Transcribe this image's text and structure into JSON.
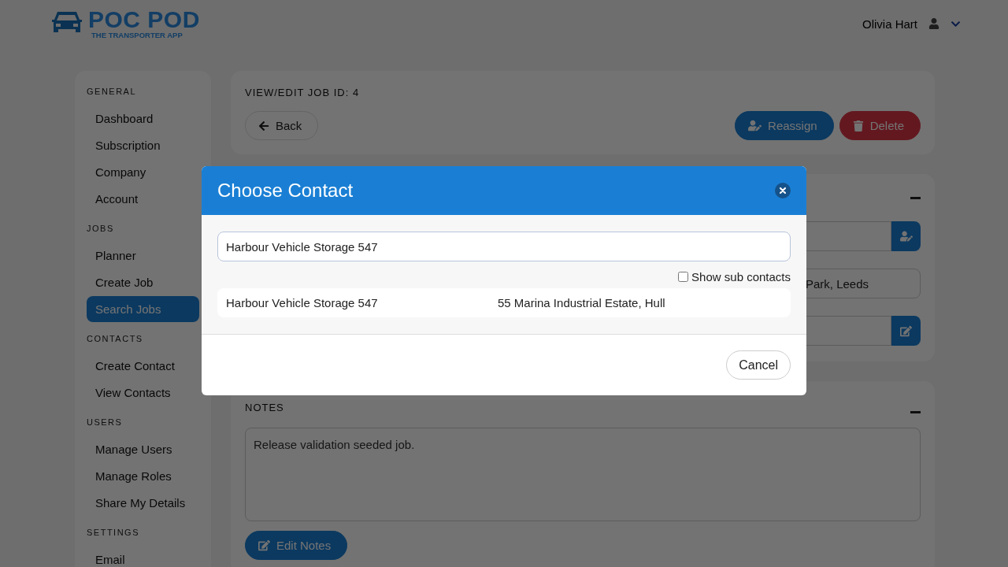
{
  "header": {
    "logo": {
      "title": "POC POD",
      "subtitle": "THE TRANSPORTER APP"
    },
    "user": {
      "name": "Olivia Hart"
    }
  },
  "sidebar": {
    "sections": [
      {
        "heading": "GENERAL",
        "items": [
          {
            "label": "Dashboard",
            "selected": false
          },
          {
            "label": "Subscription",
            "selected": false
          },
          {
            "label": "Company",
            "selected": false
          },
          {
            "label": "Account",
            "selected": false
          }
        ]
      },
      {
        "heading": "JOBS",
        "items": [
          {
            "label": "Planner",
            "selected": false
          },
          {
            "label": "Create Job",
            "selected": false
          },
          {
            "label": "Search Jobs",
            "selected": true
          }
        ]
      },
      {
        "heading": "CONTACTS",
        "items": [
          {
            "label": "Create Contact",
            "selected": false
          },
          {
            "label": "View Contacts",
            "selected": false
          }
        ]
      },
      {
        "heading": "USERS",
        "items": [
          {
            "label": "Manage Users",
            "selected": false
          },
          {
            "label": "Manage Roles",
            "selected": false
          },
          {
            "label": "Share My Details",
            "selected": false
          }
        ]
      },
      {
        "heading": "SETTINGS",
        "items": [
          {
            "label": "Email",
            "selected": false
          }
        ]
      }
    ]
  },
  "job_card": {
    "title": "VIEW/EDIT JOB ID: 4",
    "back": "Back",
    "actions": [
      {
        "label": "Reassign",
        "kind": "reassign"
      },
      {
        "label": "Delete",
        "kind": "delete"
      }
    ]
  },
  "details_card": {
    "fields": [
      {
        "kind": "assign"
      },
      {
        "kind": "plain",
        "value": "Park, Leeds"
      },
      {
        "kind": "edit"
      }
    ]
  },
  "notes_card": {
    "heading": "NOTES",
    "text": "Release validation seeded job.",
    "button": "Edit Notes"
  },
  "modal": {
    "title": "Choose Contact",
    "search": {
      "value": "Harbour Vehicle Storage 547"
    },
    "show_sub_contacts": {
      "label": "Show sub contacts",
      "checked": false
    },
    "results": [
      {
        "name": "Harbour Vehicle Storage 547",
        "address": "55 Marina Industrial Estate, Hull"
      }
    ],
    "buttons": [
      "Cancel"
    ]
  }
}
